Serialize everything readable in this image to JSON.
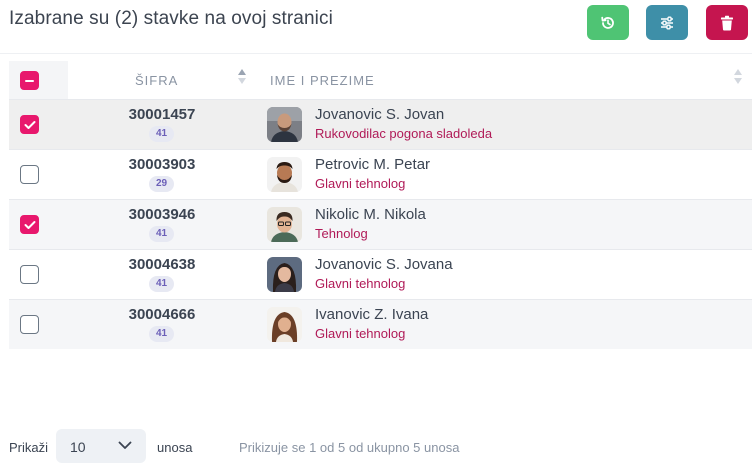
{
  "header": {
    "title": "Izabrane su (2) stavke na ovoj stranici",
    "buttons": [
      {
        "icon": "history-icon",
        "color": "#4fc474"
      },
      {
        "icon": "sliders-icon",
        "color": "#3e8fa8"
      },
      {
        "icon": "trash-icon",
        "color": "#c5154f"
      }
    ]
  },
  "table": {
    "columns": {
      "code": "ŠIFRA",
      "name": "IME I PREZIME"
    },
    "select_all_state": "indeterminate",
    "rows": [
      {
        "checked": true,
        "code": "30001457",
        "badge": "41",
        "name": "Jovanovic S. Jovan",
        "role": "Rukovodilac pogona sladoleda",
        "avatar": "avatar-man-bald"
      },
      {
        "checked": false,
        "code": "30003903",
        "badge": "29",
        "name": "Petrovic M. Petar",
        "role": "Glavni tehnolog",
        "avatar": "avatar-man-beard"
      },
      {
        "checked": true,
        "code": "30003946",
        "badge": "41",
        "name": "Nikolic M. Nikola",
        "role": "Tehnolog",
        "avatar": "avatar-man-glasses"
      },
      {
        "checked": false,
        "code": "30004638",
        "badge": "41",
        "name": "Jovanovic S. Jovana",
        "role": "Glavni tehnolog",
        "avatar": "avatar-woman-dark-hair"
      },
      {
        "checked": false,
        "code": "30004666",
        "badge": "41",
        "name": "Ivanovic Z. Ivana",
        "role": "Glavni tehnolog",
        "avatar": "avatar-woman-brown-hair"
      }
    ]
  },
  "footer": {
    "show_label": "Prikaži",
    "page_size": "10",
    "entries_label": "unosa",
    "info": "Prikizuje se 1 od 5 od ukupno 5 unosa"
  },
  "colors": {
    "accent": "#e8186d",
    "role_text": "#b01a57",
    "badge_text": "#6b5fb8"
  }
}
